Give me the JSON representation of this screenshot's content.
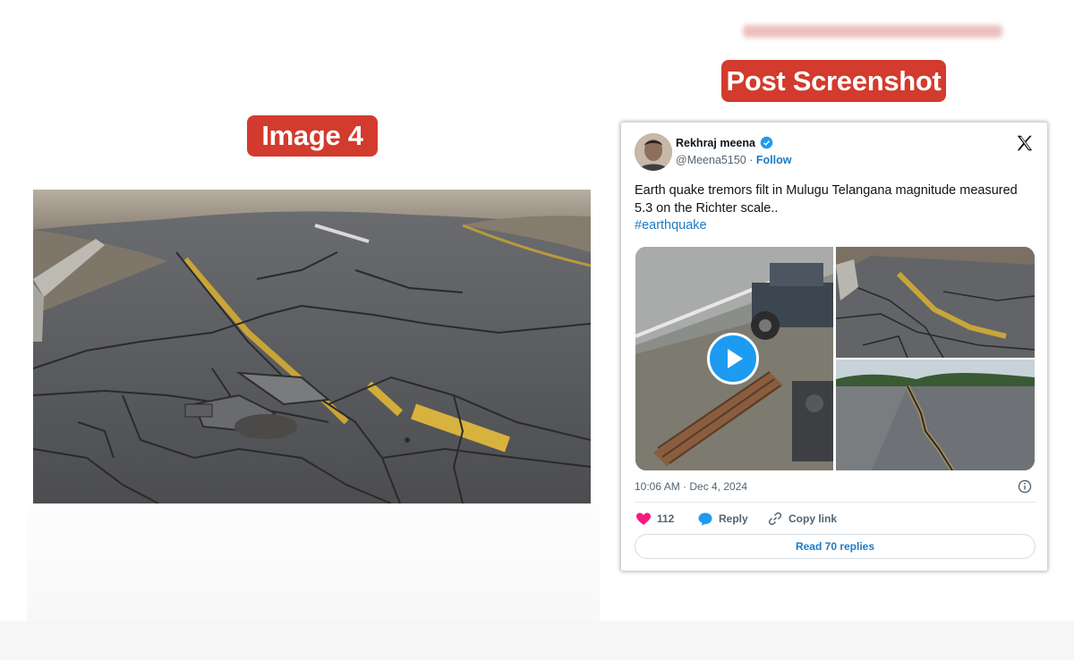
{
  "labels": {
    "image4": "Image 4",
    "post_screenshot": "Post Screenshot"
  },
  "tweet": {
    "author_name": "Rekhraj meena",
    "handle": "@Meena5150",
    "separator": "·",
    "follow_label": "Follow",
    "text": "Earth quake tremors filt in Mulugu Telangana magnitude measured 5.3 on the Richter scale..",
    "hashtag": "#earthquake",
    "timestamp": "10:06 AM · Dec 4, 2024",
    "like_count": "112",
    "reply_label": "Reply",
    "copy_link_label": "Copy link",
    "read_replies_label": "Read 70 replies"
  },
  "colors": {
    "pill_red": "#d23b2d",
    "link_blue": "#1d7bc4",
    "like_pink": "#f91880",
    "play_blue": "#1d9bf0"
  },
  "icons": [
    "verified-badge-icon",
    "x-logo-icon",
    "play-icon",
    "info-icon",
    "heart-icon",
    "reply-bubble-icon",
    "link-icon"
  ]
}
